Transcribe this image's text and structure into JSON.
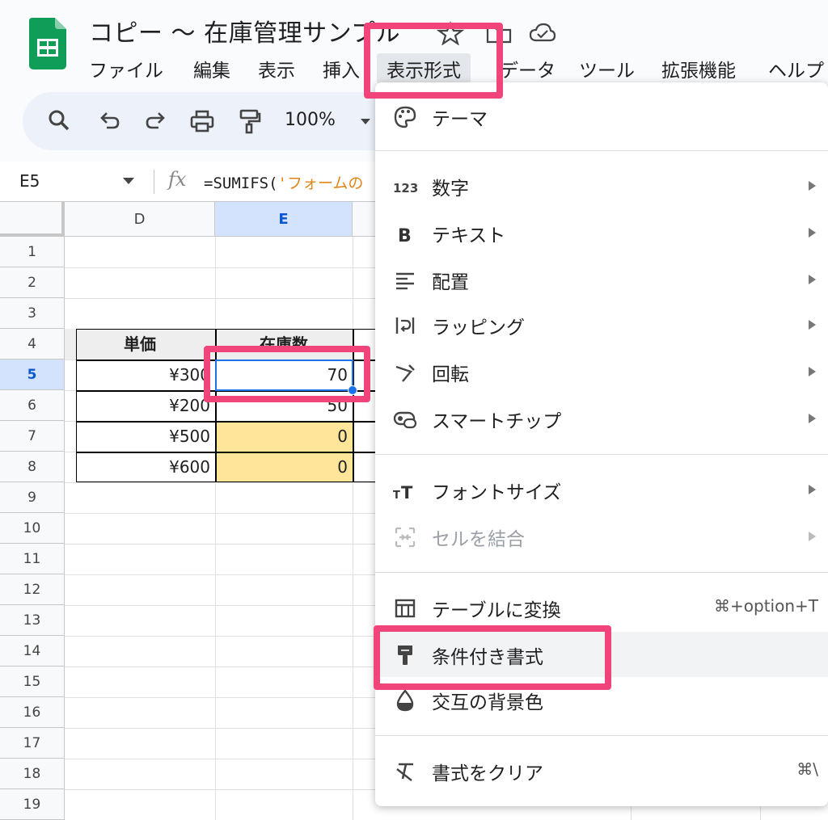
{
  "doc": {
    "title": "コピー 〜 在庫管理サンプル"
  },
  "menu": {
    "items": [
      "ファイル",
      "編集",
      "表示",
      "挿入",
      "表示形式",
      "データ",
      "ツール",
      "拡張機能",
      "ヘルプ"
    ]
  },
  "toolbar": {
    "zoom": "100%"
  },
  "formula_bar": {
    "name_box": "E5",
    "fx": "fx",
    "formula_prefix": "=SUMIFS(",
    "formula_string": "'フォームの"
  },
  "grid": {
    "columns": [
      "D",
      "E"
    ],
    "rows": [
      "1",
      "2",
      "3",
      "4",
      "5",
      "6",
      "7",
      "8",
      "9",
      "10",
      "11",
      "12",
      "13",
      "14",
      "15",
      "16",
      "17",
      "18",
      "19"
    ],
    "header_row": {
      "d": "単価",
      "e": "在庫数"
    },
    "data_rows": [
      {
        "d": "¥300",
        "e": "70"
      },
      {
        "d": "¥200",
        "e": "50"
      },
      {
        "d": "¥500",
        "e": "0"
      },
      {
        "d": "¥600",
        "e": "0"
      }
    ]
  },
  "format_menu": {
    "theme": "テーマ",
    "number": "数字",
    "text": "テキスト",
    "alignment": "配置",
    "wrapping": "ラッピング",
    "rotation": "回転",
    "smart_chips": "スマートチップ",
    "font_size": "フォントサイズ",
    "merge_cells": "セルを結合",
    "convert_table": "テーブルに変換",
    "convert_table_shortcut": "⌘+option+T",
    "conditional_formatting": "条件付き書式",
    "alternating_colors": "交互の背景色",
    "clear_formatting": "書式をクリア",
    "clear_formatting_shortcut": "⌘\\"
  },
  "colors": {
    "highlight": "#f0447a",
    "selection": "#1a73e8",
    "yellow_fill": "#ffe599",
    "sheets_green": "#0f9d58"
  }
}
